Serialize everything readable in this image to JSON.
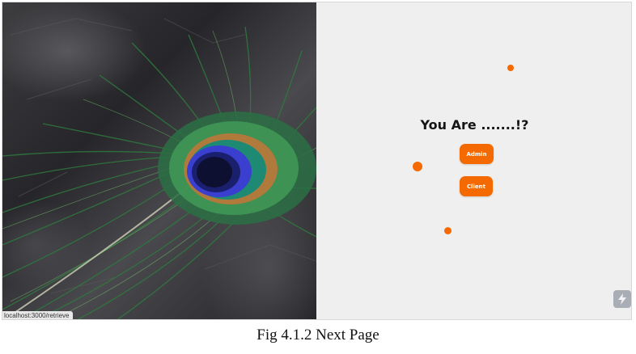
{
  "hero": {
    "image": "peacock-feather-on-slate",
    "status_url": "localhost:3000/retrieve"
  },
  "panel": {
    "question": "You Are .......!?",
    "buttons": {
      "admin_label": "Admin",
      "client_label": "Client"
    },
    "corner_icon": "lightning-icon"
  },
  "caption": "Fig 4.1.2 Next Page",
  "colors": {
    "accent": "#f56a00",
    "panel_bg": "#efefef",
    "text": "#151515"
  }
}
